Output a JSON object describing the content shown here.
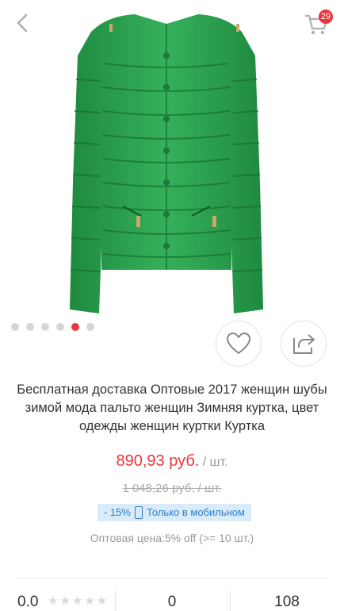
{
  "header": {
    "back_icon": "chevron-left-icon",
    "cart_icon": "shopping-cart-icon",
    "cart_count": "29"
  },
  "gallery": {
    "image": "green quilted jacket",
    "dot_count": 6,
    "active_index": 4
  },
  "actions": {
    "favorite_icon": "heart-icon",
    "share_icon": "share-icon"
  },
  "product": {
    "title": "Бесплатная доставка Оптовые 2017 женщин шубы зимой мода пальто женщин Зимняя куртка, цвет одежды женщин куртки Куртка",
    "price": "890,93 руб.",
    "unit": " / шт.",
    "old_price": "1 048,26 руб.  / шт.",
    "discount": "- 15%",
    "mobile_only": "Только в мобильном",
    "wholesale": "Оптовая цена:5% off (>= 10 шт.)"
  },
  "stats": {
    "rating": "0.0",
    "stars_filled": 0,
    "reviews": "0",
    "orders": "108"
  },
  "colors": {
    "accent": "#e8373e",
    "badge_bg": "#d9eaf8",
    "badge_text": "#2b7fd1",
    "jacket": "#2a9a4a"
  }
}
